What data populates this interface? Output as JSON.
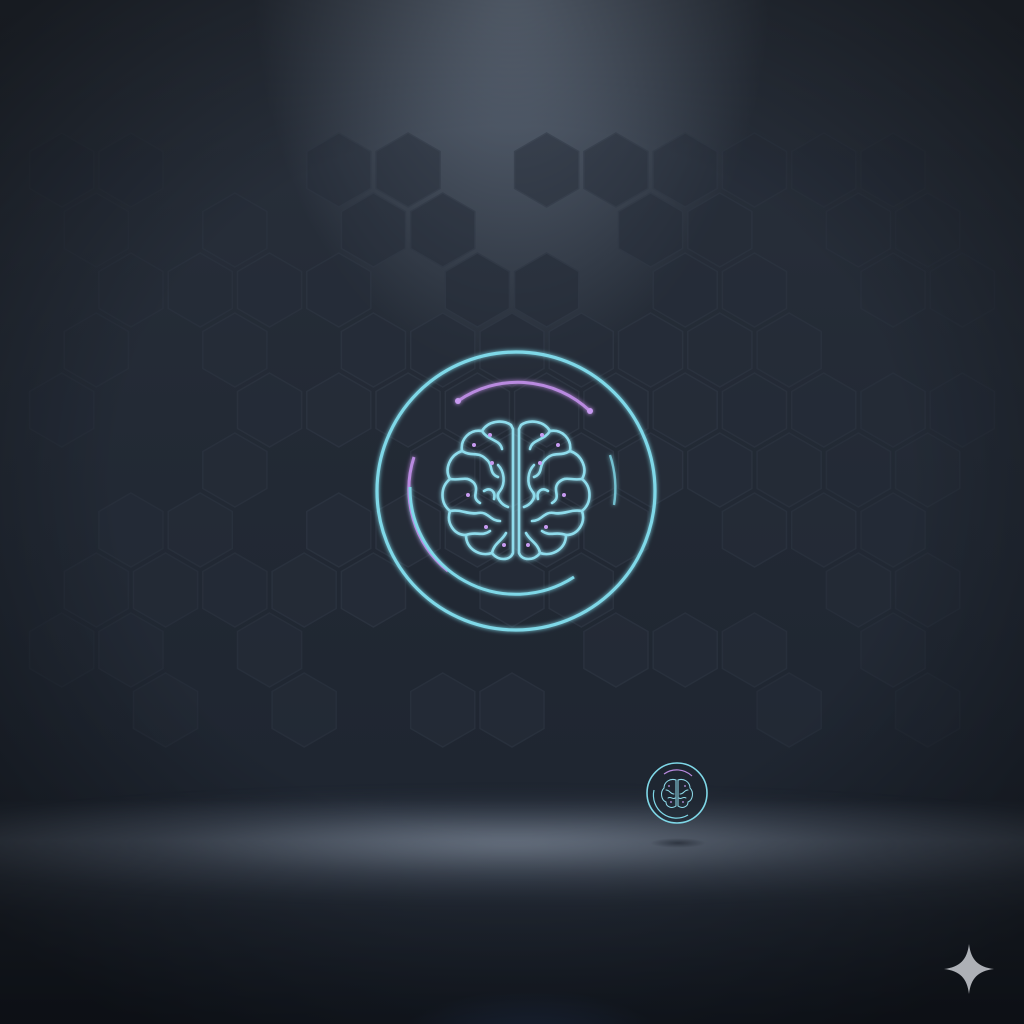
{
  "scene": {
    "description_kind": "icon-render",
    "background_color": "#232a35",
    "spotlight_color": "#96a5b9",
    "floor_color": "#8a95a6"
  },
  "emblem": {
    "icon": "brain-icon",
    "outer_ring_color": "#7fd8e8",
    "inner_arc_color": "#b98ae0",
    "brain_color": "#8fdcec",
    "dot_color": "#c79af0"
  },
  "mini_emblem": {
    "icon": "brain-icon"
  },
  "watermark": {
    "icon": "sparkle-icon",
    "color": "#c9ccd2"
  },
  "hex_pattern": {
    "fill": "#262d39",
    "stroke": "#2f3744"
  }
}
